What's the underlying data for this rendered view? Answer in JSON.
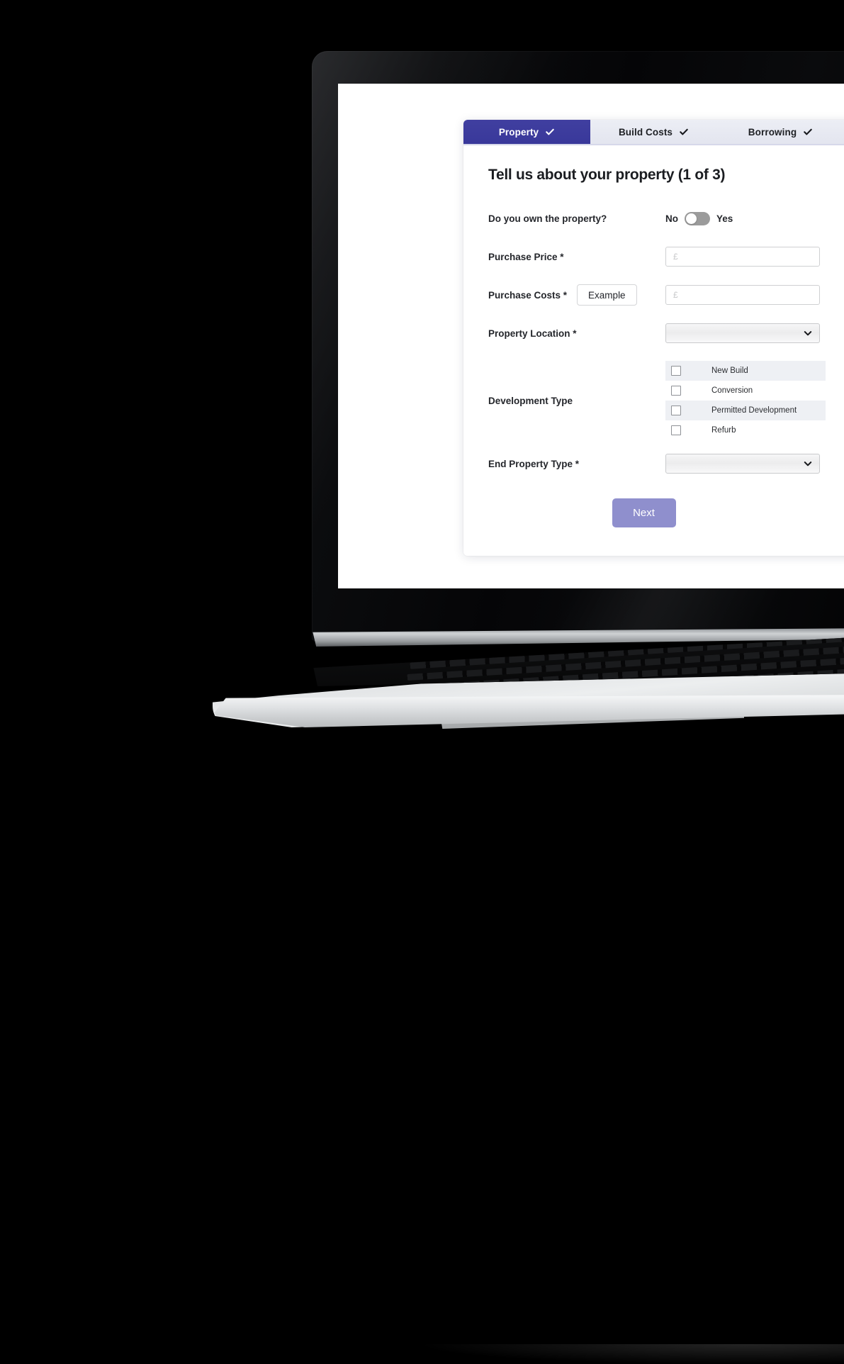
{
  "device": {
    "type": "laptop-mockup",
    "name": "macbook"
  },
  "tabs": [
    {
      "label": "Property",
      "icon": "check-icon",
      "active": true
    },
    {
      "label": "Build Costs",
      "icon": "check-icon",
      "active": false
    },
    {
      "label": "Borrowing",
      "icon": "check-icon",
      "active": false
    }
  ],
  "form": {
    "title": "Tell us about your property (1 of 3)",
    "own_property": {
      "label": "Do you own the property?",
      "off_label": "No",
      "on_label": "Yes",
      "value": "No"
    },
    "purchase_price": {
      "label": "Purchase Price *",
      "placeholder": "£",
      "value": ""
    },
    "purchase_costs": {
      "label": "Purchase Costs *",
      "example_label": "Example",
      "placeholder": "£",
      "value": ""
    },
    "property_location": {
      "label": "Property Location *",
      "value": "",
      "icon": "chevron-down-icon"
    },
    "development_type": {
      "label": "Development Type",
      "options": [
        {
          "label": "New Build",
          "checked": false
        },
        {
          "label": "Conversion",
          "checked": false
        },
        {
          "label": "Permitted Development",
          "checked": false
        },
        {
          "label": "Refurb",
          "checked": false
        }
      ]
    },
    "end_property_type": {
      "label": "End Property Type *",
      "value": "",
      "icon": "chevron-down-icon"
    },
    "next_label": "Next"
  },
  "colors": {
    "tab_active_bg": "#3f3f9e",
    "tab_inactive_bg": "#e7e8f0",
    "next_button_bg": "#8f8fcd",
    "stripe_bg": "#eef0f4",
    "toggle_bg": "#9b9b9b",
    "page_bg": "#ffffff",
    "backdrop": "#000000"
  }
}
